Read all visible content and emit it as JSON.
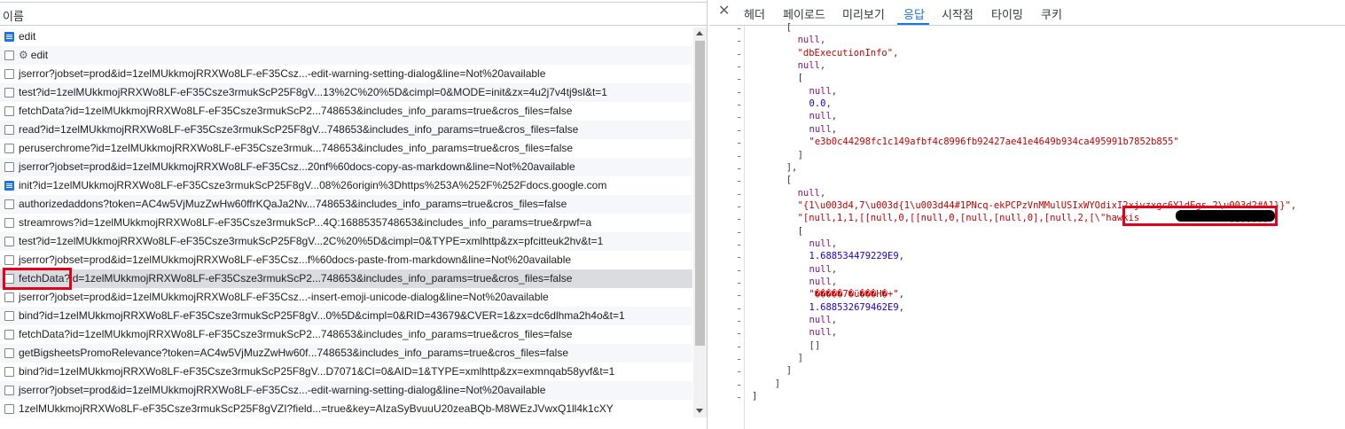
{
  "left_panel": {
    "header": "이름",
    "rows": [
      {
        "icon": "doc",
        "label": "edit",
        "gear": false
      },
      {
        "icon": "blank",
        "label": "edit",
        "gear": true
      },
      {
        "icon": "blank",
        "label": "jserror?jobset=prod&id=1zelMUkkmojRRXWo8LF-eF35Csz...-edit-warning-setting-dialog&line=Not%20available"
      },
      {
        "icon": "blank",
        "label": "test?id=1zelMUkkmojRRXWo8LF-eF35Csze3rmukScP25F8gV...13%2C%20%5D&cimpl=0&MODE=init&zx=4u2j7v4tj9sl&t=1"
      },
      {
        "icon": "blank",
        "label": "fetchData?id=1zelMUkkmojRRXWo8LF-eF35Csze3rmukScP2...748653&includes_info_params=true&cros_files=false"
      },
      {
        "icon": "blank",
        "label": "read?id=1zelMUkkmojRRXWo8LF-eF35Csze3rmukScP25F8gV...748653&includes_info_params=true&cros_files=false"
      },
      {
        "icon": "blank",
        "label": "peruserchrome?id=1zelMUkkmojRRXWo8LF-eF35Csze3rmuk...748653&includes_info_params=true&cros_files=false"
      },
      {
        "icon": "blank",
        "label": "jserror?jobset=prod&id=1zelMUkkmojRRXWo8LF-eF35Csz...20nf%60docs-copy-as-markdown&line=Not%20available"
      },
      {
        "icon": "doc",
        "label": "init?id=1zelMUkkmojRRXWo8LF-eF35Csze3rmukScP25F8gV...08%26origin%3Dhttps%253A%252F%252Fdocs.google.com"
      },
      {
        "icon": "blank",
        "label": "authorizedaddons?token=AC4w5VjMuzZwHw60ffrKQaJa2Nv...748653&includes_info_params=true&cros_files=false"
      },
      {
        "icon": "blank",
        "label": "streamrows?id=1zelMUkkmojRRXWo8LF-eF35Csze3rmukScP...4Q:1688535748653&includes_info_params=true&rpwf=a"
      },
      {
        "icon": "blank",
        "label": "test?id=1zelMUkkmojRRXWo8LF-eF35Csze3rmukScP25F8gV...2C%20%5D&cimpl=0&TYPE=xmlhttp&zx=pfcitteuk2hv&t=1"
      },
      {
        "icon": "blank",
        "label": "jserror?jobset=prod&id=1zelMUkkmojRRXWo8LF-eF35Csz...f%60docs-paste-from-markdown&line=Not%20available"
      },
      {
        "icon": "blank",
        "label": "fetchData?id=1zelMUkkmojRRXWo8LF-eF35Csze3rmukScP2...748653&includes_info_params=true&cros_files=false",
        "selected": true
      },
      {
        "icon": "blank",
        "label": "jserror?jobset=prod&id=1zelMUkkmojRRXWo8LF-eF35Csz...-insert-emoji-unicode-dialog&line=Not%20available"
      },
      {
        "icon": "blank",
        "label": "bind?id=1zelMUkkmojRRXWo8LF-eF35Csze3rmukScP25F8gV...0%5D&cimpl=0&RID=43679&CVER=1&zx=dc6dlhma2h4o&t=1"
      },
      {
        "icon": "blank",
        "label": "fetchData?id=1zelMUkkmojRRXWo8LF-eF35Csze3rmukScP2...748653&includes_info_params=true&cros_files=false"
      },
      {
        "icon": "blank",
        "label": "getBigsheetsPromoRelevance?token=AC4w5VjMuzZwHw60f...748653&includes_info_params=true&cros_files=false"
      },
      {
        "icon": "blank",
        "label": "bind?id=1zelMUkkmojRRXWo8LF-eF35Csze3rmukScP25F8gV...D7071&CI=0&AID=1&TYPE=xmlhttp&zx=exmnqab58yvf&t=1"
      },
      {
        "icon": "blank",
        "label": "jserror?jobset=prod&id=1zelMUkkmojRRXWo8LF-eF35Csz...-edit-warning-setting-dialog&line=Not%20available"
      },
      {
        "icon": "blank",
        "label": "1zelMUkkmojRRXWo8LF-eF35Csze3rmukScP25F8gVZI?field...=true&key=AIzaSyBvuuU20zeaBQb-M8WEzJVwxQ1ll4k1cXY"
      }
    ]
  },
  "right_panel": {
    "close_icon": "close-icon",
    "tabs": [
      "헤더",
      "페이로드",
      "미리보기",
      "응답",
      "시작점",
      "타이밍",
      "쿠키"
    ],
    "active_tab": "응답",
    "response_lines": [
      {
        "indent": 6,
        "tokens": [
          {
            "t": "[",
            "c": "pun"
          }
        ]
      },
      {
        "indent": 8,
        "tokens": [
          {
            "t": "null",
            "c": "kw"
          },
          {
            "t": ",",
            "c": "pun"
          }
        ]
      },
      {
        "indent": 8,
        "tokens": [
          {
            "t": "\"dbExecutionInfo\"",
            "c": "str"
          },
          {
            "t": ",",
            "c": "pun"
          }
        ]
      },
      {
        "indent": 8,
        "tokens": [
          {
            "t": "null",
            "c": "kw"
          },
          {
            "t": ",",
            "c": "pun"
          }
        ]
      },
      {
        "indent": 8,
        "tokens": [
          {
            "t": "[",
            "c": "pun"
          }
        ]
      },
      {
        "indent": 10,
        "tokens": [
          {
            "t": "null",
            "c": "kw"
          },
          {
            "t": ",",
            "c": "pun"
          }
        ]
      },
      {
        "indent": 10,
        "tokens": [
          {
            "t": "0.0",
            "c": "num"
          },
          {
            "t": ",",
            "c": "pun"
          }
        ]
      },
      {
        "indent": 10,
        "tokens": [
          {
            "t": "null",
            "c": "kw"
          },
          {
            "t": ",",
            "c": "pun"
          }
        ]
      },
      {
        "indent": 10,
        "tokens": [
          {
            "t": "null",
            "c": "kw"
          },
          {
            "t": ",",
            "c": "pun"
          }
        ]
      },
      {
        "indent": 10,
        "tokens": [
          {
            "t": "\"e3b0c44298fc1c149afbf4c8996fb92427ae41e4649b934ca495991b7852b855\"",
            "c": "str"
          }
        ]
      },
      {
        "indent": 8,
        "tokens": [
          {
            "t": "]",
            "c": "pun"
          }
        ]
      },
      {
        "indent": 6,
        "tokens": [
          {
            "t": "],",
            "c": "pun"
          }
        ]
      },
      {
        "indent": 6,
        "tokens": [
          {
            "t": "[",
            "c": "pun"
          }
        ]
      },
      {
        "indent": 8,
        "tokens": [
          {
            "t": "null",
            "c": "kw"
          },
          {
            "t": ",",
            "c": "pun"
          }
        ]
      },
      {
        "indent": 8,
        "tokens": [
          {
            "t": "\"{1\\u003d4,7\\u003d{1\\u003d44#1PNcq-ekPCPzVnMMulUSIxWYOdixI2xjvzxgc6YldEgs_2\\u003d2#A1}}\"",
            "c": "str"
          },
          {
            "t": ",",
            "c": "pun"
          }
        ]
      },
      {
        "indent": 8,
        "tokens": [
          {
            "t": "\"[null,1,1,[[null,0,[[null,0,[null,[null,0],[null,2,[\\\"hawkis",
            "c": "str"
          },
          {
            "t": "              ",
            "c": "pun"
          },
          {
            "t": "\\\"]]]]]]]\"",
            "c": "str"
          },
          {
            "t": ",",
            "c": "pun"
          }
        ]
      },
      {
        "indent": 8,
        "tokens": [
          {
            "t": "[",
            "c": "pun"
          }
        ]
      },
      {
        "indent": 10,
        "tokens": [
          {
            "t": "null",
            "c": "kw"
          },
          {
            "t": ",",
            "c": "pun"
          }
        ]
      },
      {
        "indent": 10,
        "tokens": [
          {
            "t": "1.688534479229E9",
            "c": "num"
          },
          {
            "t": ",",
            "c": "pun"
          }
        ]
      },
      {
        "indent": 10,
        "tokens": [
          {
            "t": "null",
            "c": "kw"
          },
          {
            "t": ",",
            "c": "pun"
          }
        ]
      },
      {
        "indent": 10,
        "tokens": [
          {
            "t": "null",
            "c": "kw"
          },
          {
            "t": ",",
            "c": "pun"
          }
        ]
      },
      {
        "indent": 10,
        "tokens": [
          {
            "t": "\"�����7�ü���H�+\"",
            "c": "str"
          },
          {
            "t": ",",
            "c": "pun"
          }
        ]
      },
      {
        "indent": 10,
        "tokens": [
          {
            "t": "1.688532679462E9",
            "c": "num"
          },
          {
            "t": ",",
            "c": "pun"
          }
        ]
      },
      {
        "indent": 10,
        "tokens": [
          {
            "t": "null",
            "c": "kw"
          },
          {
            "t": ",",
            "c": "pun"
          }
        ]
      },
      {
        "indent": 10,
        "tokens": [
          {
            "t": "null",
            "c": "kw"
          },
          {
            "t": ",",
            "c": "pun"
          }
        ]
      },
      {
        "indent": 10,
        "tokens": [
          {
            "t": "[]",
            "c": "pun"
          }
        ]
      },
      {
        "indent": 8,
        "tokens": [
          {
            "t": "]",
            "c": "pun"
          }
        ]
      },
      {
        "indent": 6,
        "tokens": [
          {
            "t": "]",
            "c": "pun"
          }
        ]
      },
      {
        "indent": 4,
        "tokens": [
          {
            "t": "]",
            "c": "pun"
          }
        ]
      },
      {
        "indent": 0,
        "tokens": [
          {
            "t": "]",
            "c": "pun"
          }
        ]
      }
    ],
    "gutter_mark": "-"
  }
}
